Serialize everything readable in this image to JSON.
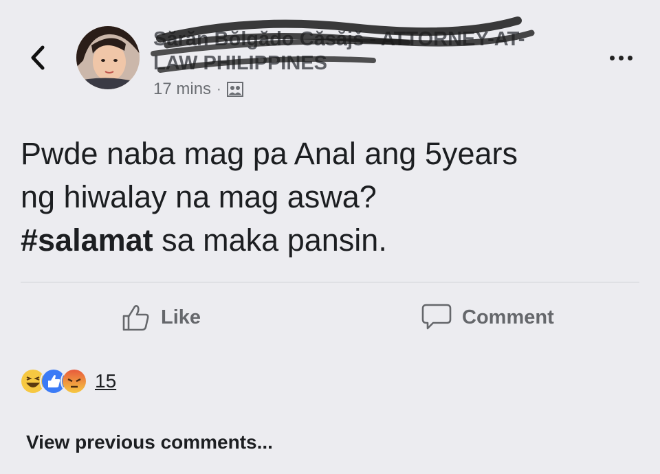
{
  "header": {
    "author_name": "Sărăn Bŏlgădo Căsăjš - ATTORNEY-AT-LAW PHILIPPINES",
    "timestamp": "17 mins",
    "separator": "·",
    "privacy_icon": "group-icon"
  },
  "post": {
    "line1": "Pwde naba mag pa Anal ang 5years",
    "line2": "ng hiwalay na mag aswa?",
    "hashtag": "#salamat",
    "line3_rest": " sa maka pansin."
  },
  "actions": {
    "like_label": "Like",
    "comment_label": "Comment"
  },
  "reactions": {
    "types": [
      "haha",
      "like",
      "angry"
    ],
    "count": "15"
  },
  "comments": {
    "view_previous": "View previous comments..."
  },
  "colors": {
    "background": "#ececf0",
    "like_blue": "#3b7bf6",
    "haha_yellow": "#f6c842",
    "angry_red": "#e85a3c"
  }
}
